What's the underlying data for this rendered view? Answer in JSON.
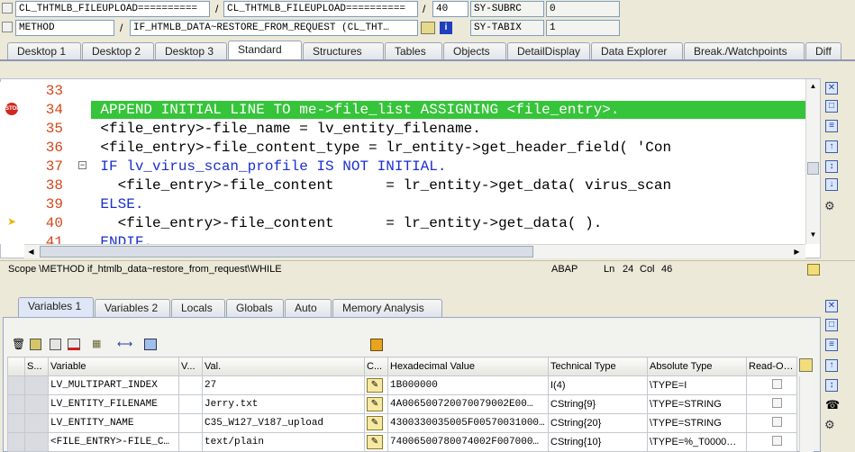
{
  "top_row1": {
    "field1": "CL_THTMLB_FILEUPLOAD==========",
    "sep1": "/",
    "field2": "CL_THTMLB_FILEUPLOAD==========",
    "sep2": "/",
    "field3": "40",
    "field4": "SY-SUBRC",
    "field5": "0"
  },
  "top_row2": {
    "field1": "METHOD",
    "sep1": "/",
    "field2": "IF_HTMLB_DATA~RESTORE_FROM_REQUEST (CL_THT…",
    "field4": "SY-TABIX",
    "field5": "1"
  },
  "tabs": [
    "Desktop 1",
    "Desktop 2",
    "Desktop 3",
    "Standard",
    "Structures",
    "Tables",
    "Objects",
    "DetailDisplay",
    "Data Explorer",
    "Break./Watchpoints",
    "Diff"
  ],
  "active_tab": "Standard",
  "code_lines": [
    {
      "num": "33",
      "text": ""
    },
    {
      "num": "34",
      "text": "    APPEND INITIAL LINE TO me->file_list ASSIGNING <file_entry>."
    },
    {
      "num": "35",
      "text": "    <file_entry>-file_name = lv_entity_filename."
    },
    {
      "num": "36",
      "text": "    <file_entry>-file_content_type = lr_entity->get_header_field( 'Con"
    },
    {
      "num": "37",
      "text": "    IF lv_virus_scan_profile IS NOT INITIAL."
    },
    {
      "num": "38",
      "text": "      <file_entry>-file_content      = lr_entity->get_data( virus_scan"
    },
    {
      "num": "39",
      "text": "    ELSE."
    },
    {
      "num": "40",
      "text": "      <file_entry>-file_content      = lr_entity->get_data( )."
    },
    {
      "num": "41",
      "text": "    ENDIF."
    }
  ],
  "status": {
    "scope": "Scope \\METHOD if_htmlb_data~restore_from_request\\WHILE",
    "lang": "ABAP",
    "ln_label": "Ln",
    "ln": "24",
    "col_label": "Col",
    "col": "46"
  },
  "var_tabs": [
    "Variables 1",
    "Variables 2",
    "Locals",
    "Globals",
    "Auto",
    "Memory Analysis"
  ],
  "grid": {
    "headers": [
      "S...",
      "Variable",
      "V...",
      "Val.",
      "C...",
      "Hexadecimal Value",
      "Technical Type",
      "Absolute Type",
      "Read-Only"
    ],
    "rows": [
      {
        "variable": "LV_MULTIPART_INDEX",
        "value": "27",
        "hex": "1B000000",
        "tech": "I(4)",
        "abs": "\\TYPE=I"
      },
      {
        "variable": "LV_ENTITY_FILENAME",
        "value": "Jerry.txt",
        "hex": "4A006500720070079002E00…",
        "tech": "CString{9}",
        "abs": "\\TYPE=STRING"
      },
      {
        "variable": "LV_ENTITY_NAME",
        "value": "C35_W127_V187_upload",
        "hex": "4300330035005F00570031000…",
        "tech": "CString{20}",
        "abs": "\\TYPE=STRING"
      },
      {
        "variable": "<FILE_ENTRY>-FILE_C…",
        "value": "text/plain",
        "hex": "74006500780074002F007000…",
        "tech": "CString{10}",
        "abs": "\\TYPE=%_T0000…"
      }
    ]
  }
}
